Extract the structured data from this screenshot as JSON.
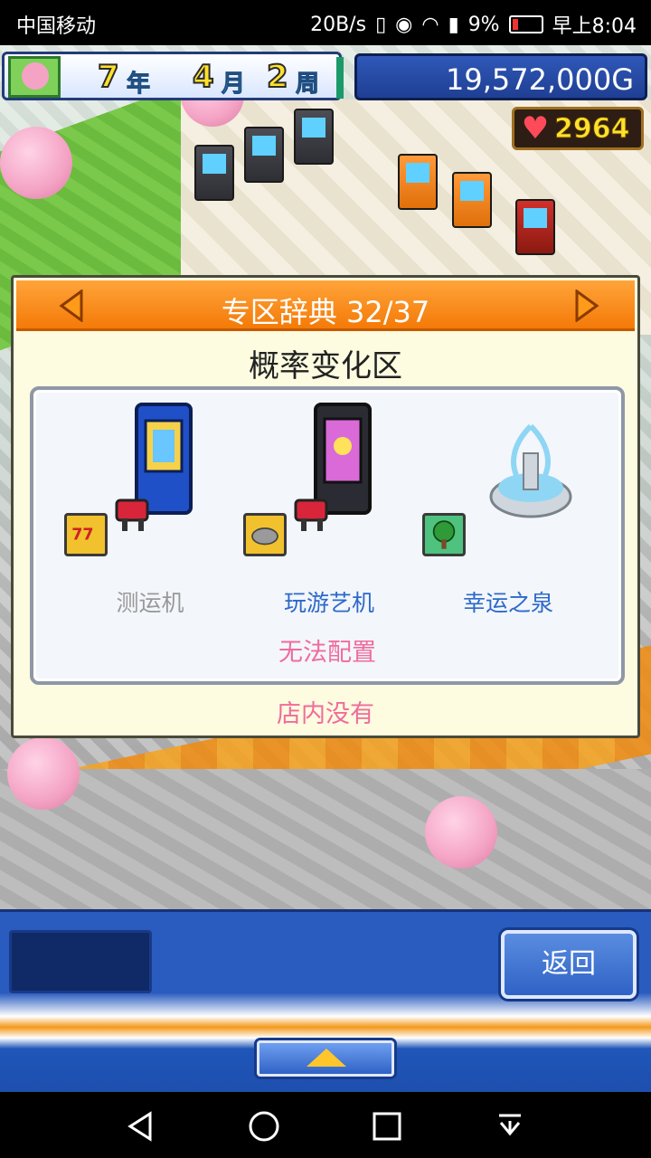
{
  "status_bar": {
    "carrier": "中国移动",
    "speed": "20B/s",
    "battery": "9%",
    "time": "早上8:04"
  },
  "hud": {
    "year_num": "7",
    "year_unit": "年",
    "month_num": "4",
    "month_unit": "月",
    "week_num": "2",
    "week_unit": "周",
    "money": "19,572,000G",
    "hearts": "2964"
  },
  "dialog": {
    "title": "专区辞典 32/37",
    "category": "概率变化区",
    "items": [
      {
        "label": "测运机",
        "label_color": "gray",
        "badge_icon": "seven-icon"
      },
      {
        "label": "玩游艺机",
        "label_color": "blue",
        "badge_icon": "rock-icon"
      },
      {
        "label": "幸运之泉",
        "label_color": "blue",
        "badge_icon": "tree-icon"
      }
    ],
    "status_config": "无法配置",
    "status_store": "店内没有"
  },
  "bottom": {
    "back_label": "返回"
  },
  "colors": {
    "header_orange": "#f47a08",
    "pink_text": "#f06c9b",
    "blue_text": "#2c69c9",
    "money_blue": "#1f3f93"
  }
}
